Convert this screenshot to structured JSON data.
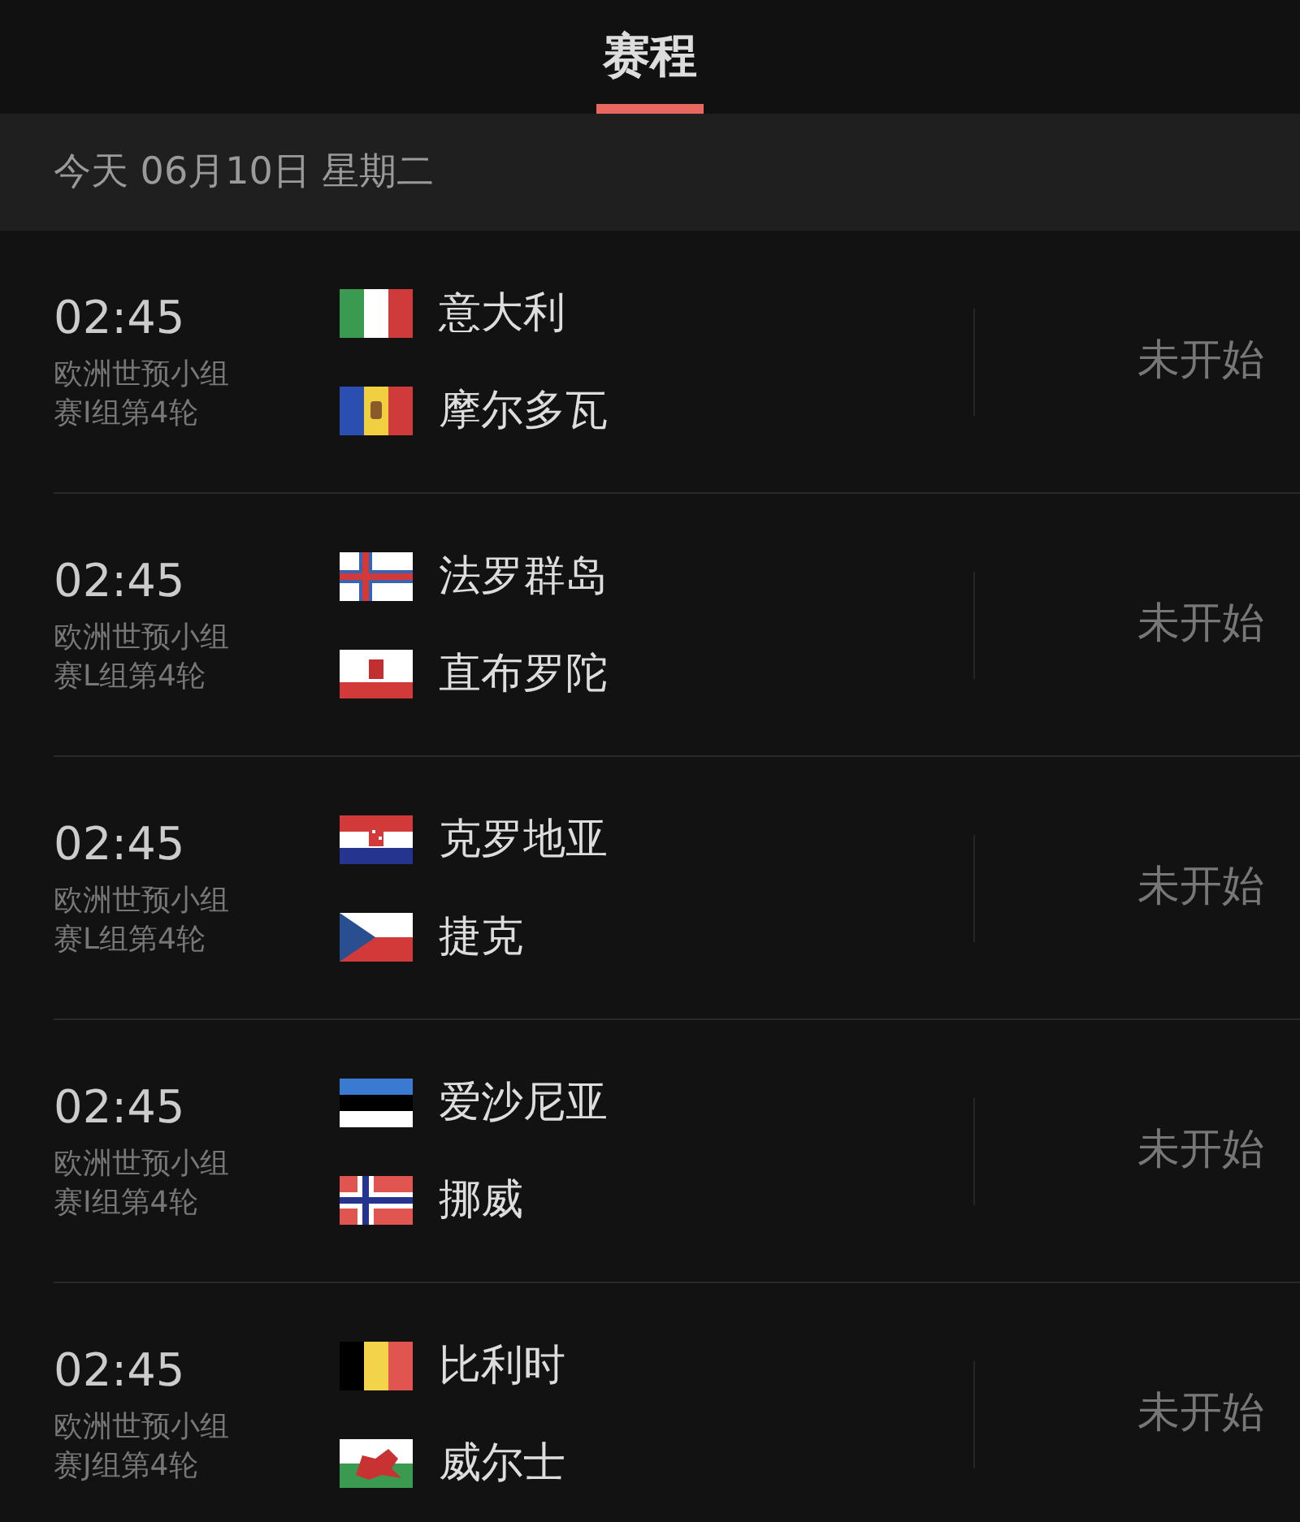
{
  "tabs": [
    {
      "label": "赛程",
      "selected": true
    }
  ],
  "date_header": "今天 06月10日 星期二",
  "matches": [
    {
      "time": "02:45",
      "competition": [
        "欧洲世预小组",
        "赛I组第4轮"
      ],
      "teams": [
        {
          "name": "意大利",
          "kind": "it"
        },
        {
          "name": "摩尔多瓦",
          "kind": "md"
        }
      ],
      "status": "未开始"
    },
    {
      "time": "02:45",
      "competition": [
        "欧洲世预小组",
        "赛L组第4轮"
      ],
      "teams": [
        {
          "name": "法罗群岛",
          "kind": "fo"
        },
        {
          "name": "直布罗陀",
          "kind": "gi"
        }
      ],
      "status": "未开始"
    },
    {
      "time": "02:45",
      "competition": [
        "欧洲世预小组",
        "赛L组第4轮"
      ],
      "teams": [
        {
          "name": "克罗地亚",
          "kind": "hr"
        },
        {
          "name": "捷克",
          "kind": "cz"
        }
      ],
      "status": "未开始"
    },
    {
      "time": "02:45",
      "competition": [
        "欧洲世预小组",
        "赛I组第4轮"
      ],
      "teams": [
        {
          "name": "爱沙尼亚",
          "kind": "ee"
        },
        {
          "name": "挪威",
          "kind": "no"
        }
      ],
      "status": "未开始"
    },
    {
      "time": "02:45",
      "competition": [
        "欧洲世预小组",
        "赛J组第4轮"
      ],
      "teams": [
        {
          "name": "比利时",
          "kind": "be"
        },
        {
          "name": "威尔士",
          "kind": "wl"
        }
      ],
      "status": "未开始"
    }
  ]
}
